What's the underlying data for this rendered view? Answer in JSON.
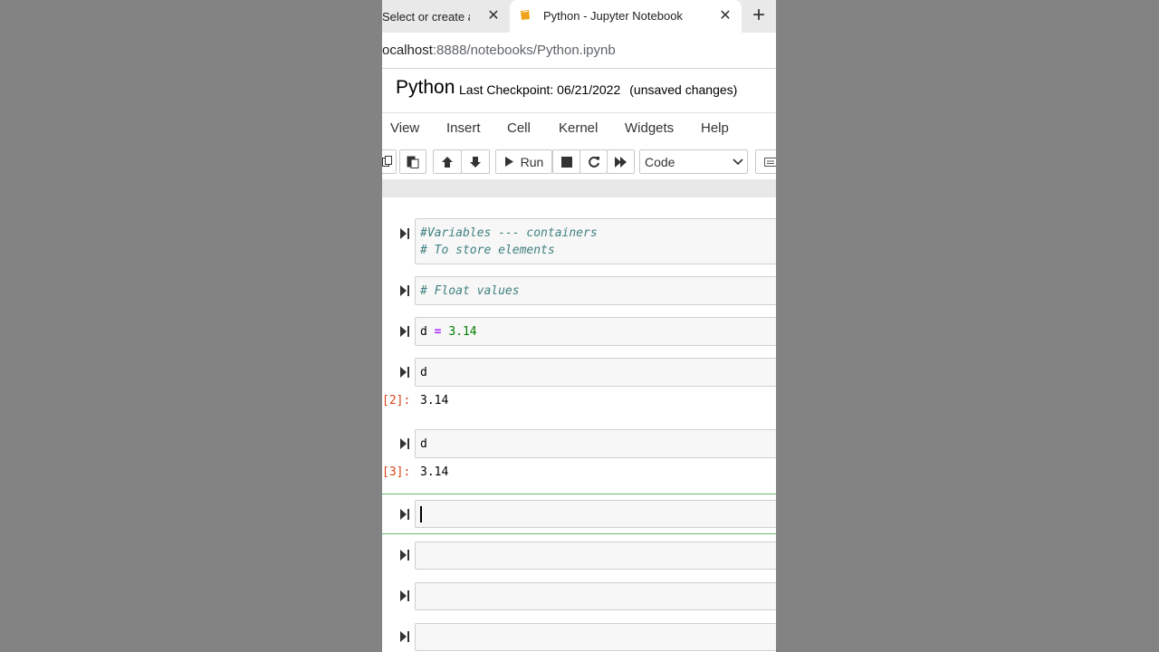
{
  "browser": {
    "inactive_tab_title": "Select or create a n",
    "active_tab_title": "Python - Jupyter Notebook",
    "url_host": "ocalhost",
    "url_path": ":8888/notebooks/Python.ipynb"
  },
  "header": {
    "notebook_name": "Python",
    "checkpoint": "Last Checkpoint: 06/21/2022",
    "status": "(unsaved changes)"
  },
  "menu": [
    "View",
    "Insert",
    "Cell",
    "Kernel",
    "Widgets",
    "Help"
  ],
  "toolbar": {
    "run_label": "Run",
    "cell_type": "Code"
  },
  "cells": [
    {
      "lines": [
        "#Variables --- containers",
        "# To store elements"
      ]
    },
    {
      "lines": [
        "# Float values"
      ]
    },
    {
      "code_var": "d",
      "code_op": "=",
      "code_num": "3.14"
    },
    {
      "code": "d",
      "out_prompt": "[2]:",
      "output": "3.14"
    },
    {
      "code": "d",
      "out_prompt": "[3]:",
      "output": "3.14"
    }
  ]
}
